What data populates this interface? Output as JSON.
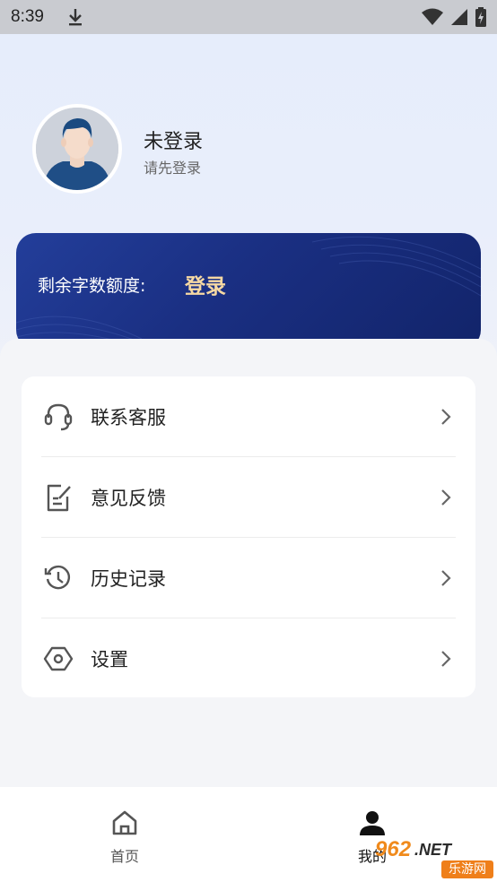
{
  "status_bar": {
    "time": "8:39",
    "icons": [
      "download-icon",
      "wifi-icon",
      "signal-icon",
      "battery-icon"
    ]
  },
  "profile": {
    "name": "未登录",
    "hint": "请先登录"
  },
  "quota": {
    "label": "剩余字数额度:",
    "login": "登录"
  },
  "menu": {
    "items": [
      {
        "label": "联系客服",
        "icon": "headset-icon"
      },
      {
        "label": "意见反馈",
        "icon": "feedback-icon"
      },
      {
        "label": "历史记录",
        "icon": "history-icon"
      },
      {
        "label": "设置",
        "icon": "settings-icon"
      }
    ]
  },
  "bottom_nav": {
    "home": "首页",
    "mine": "我的"
  },
  "watermark": {
    "brand": "962",
    "suffix": ".NET",
    "site": "乐游网"
  },
  "colors": {
    "banner": "#1a2f82",
    "banner_accent": "#f6d9a3",
    "watermark": "#ef7f1a"
  }
}
